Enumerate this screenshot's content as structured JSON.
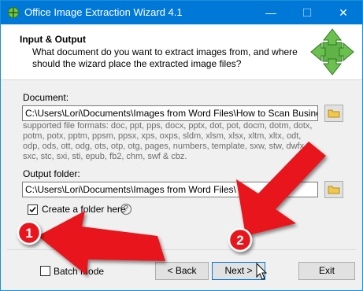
{
  "window": {
    "title": "Office Image Extraction Wizard 4.1",
    "minimize": "—",
    "maximize": "☐",
    "close": "✕"
  },
  "header": {
    "title": "Input & Output",
    "description": "What document do you want to extract images from, and where should the wizard place the extracted image files?"
  },
  "document": {
    "label": "Document:",
    "value": "C:\\Users\\Lori\\Documents\\Images from Word Files\\How to Scan Business Card",
    "formats": "supported file formats: doc, ppt, pps, docx, pptx, dot, pot, docm, dotm, dotx, potm, potx, pptm, ppsm, ppsx, xps, oxps, sldm, xlsm, xlsx, xltm, xltx, odt, odp, ods, ott, odg, ots, otp, otg, pages, numbers, template, sxw, stw, dwfx, sxc, stc, sxi, sti, epub, fb2, chm, swf & cbz."
  },
  "output": {
    "label": "Output folder:",
    "value": "C:\\Users\\Lori\\Documents\\Images from Word Files\\",
    "create_folder_label": "Create a folder here",
    "create_folder_checked": true,
    "help_glyph": "?"
  },
  "footer": {
    "batch_mode_label": "Batch Mode",
    "batch_mode_checked": false,
    "back_label": "< Back",
    "next_label": "Next >",
    "exit_label": "Exit"
  },
  "annotations": {
    "badge1": "1",
    "badge2": "2",
    "arrow_color": "#e8141b"
  },
  "colors": {
    "titlebar": "#0078d7",
    "accent": "#0078d7",
    "icon_green": "#4aa03a"
  }
}
